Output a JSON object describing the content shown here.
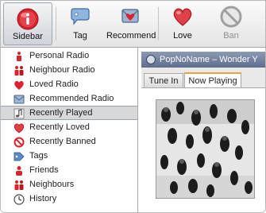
{
  "toolbar": {
    "buttons": [
      {
        "label": "Sidebar",
        "icon": "sidebar-icon",
        "state": "active"
      },
      {
        "label": "Tag",
        "icon": "tag-icon",
        "state": "normal"
      },
      {
        "label": "Recommend",
        "icon": "recommend-icon",
        "state": "normal"
      },
      {
        "label": "Love",
        "icon": "heart-icon",
        "state": "normal"
      },
      {
        "label": "Ban",
        "icon": "ban-icon",
        "state": "disabled"
      }
    ]
  },
  "sidebar": {
    "items": [
      {
        "label": "Personal Radio",
        "icon": "personal-radio-icon"
      },
      {
        "label": "Neighbour Radio",
        "icon": "neighbour-radio-icon"
      },
      {
        "label": "Loved Radio",
        "icon": "loved-radio-icon"
      },
      {
        "label": "Recommended Radio",
        "icon": "recommended-radio-icon"
      },
      {
        "label": "Recently Played",
        "icon": "music-note-icon",
        "selected": true
      },
      {
        "label": "Recently Loved",
        "icon": "heart-icon"
      },
      {
        "label": "Recently Banned",
        "icon": "ban-icon"
      },
      {
        "label": "Tags",
        "icon": "tag-icon"
      },
      {
        "label": "Friends",
        "icon": "friends-icon"
      },
      {
        "label": "Neighbours",
        "icon": "neighbours-icon"
      },
      {
        "label": "History",
        "icon": "clock-icon"
      }
    ]
  },
  "now_playing": {
    "text": "PopNoName – Wonder Y"
  },
  "tabs": [
    {
      "label": "Tune In",
      "active": false
    },
    {
      "label": "Now Playing",
      "active": true
    }
  ],
  "colors": {
    "accent_red": "#d9232e",
    "header_blue": "#6b7a98",
    "tab_highlight": "#e8a33a"
  }
}
